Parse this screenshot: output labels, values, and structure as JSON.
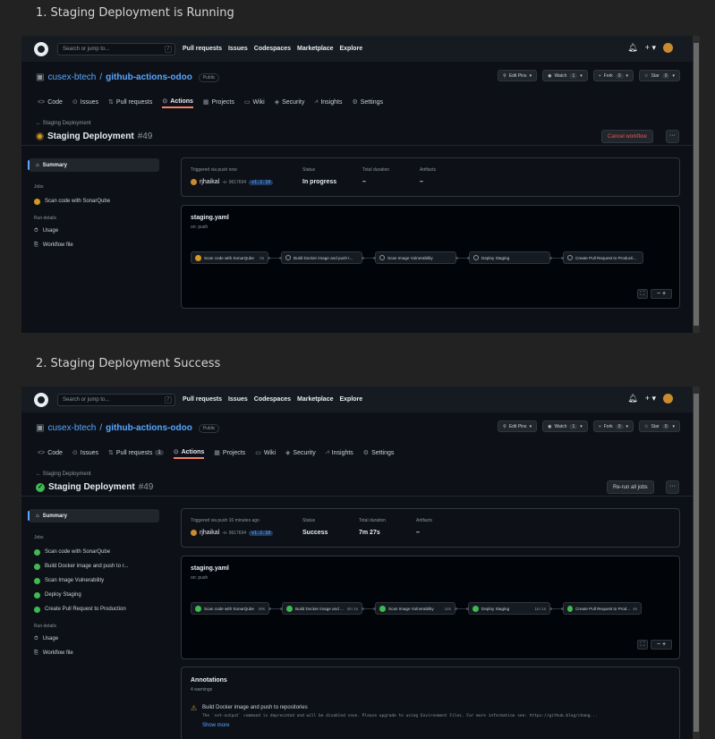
{
  "sections": [
    {
      "title": "1. Staging Deployment is Running",
      "search_placeholder": "Search or jump to...",
      "nav": [
        "Pull requests",
        "Issues",
        "Codespaces",
        "Marketplace",
        "Explore"
      ],
      "repo": {
        "owner": "cusex-btech",
        "name": "github-actions-odoo",
        "visibility": "Public"
      },
      "repo_actions": {
        "pins": "Edit Pins",
        "watch": "Watch",
        "watch_count": "1",
        "fork": "Fork",
        "fork_count": "0",
        "star": "Star",
        "star_count": "0"
      },
      "tabs": [
        "Code",
        "Issues",
        "Pull requests",
        "Actions",
        "Projects",
        "Wiki",
        "Security",
        "Insights",
        "Settings"
      ],
      "pr_count": "",
      "breadcrumb": "← Staging Deployment",
      "run_title": "Staging Deployment",
      "run_number": "#49",
      "primary_button": "Cancel workflow",
      "sidebar": {
        "summary": "Summary",
        "jobs_heading": "Jobs",
        "jobs": [
          "Scan code with SonarQube"
        ],
        "run_details_heading": "Run details",
        "usage": "Usage",
        "workflow_file": "Workflow file"
      },
      "summary": {
        "trigger_label": "Triggered via push now",
        "user": "rjhaikal",
        "sha": "-o- 9617694",
        "tag": "v1.2.10",
        "status_label": "Status",
        "status": "In progress",
        "duration_label": "Total duration",
        "duration": "–",
        "artifacts_label": "Artifacts",
        "artifacts": "–"
      },
      "graph": {
        "file": "staging.yaml",
        "on": "on: push",
        "jobs": [
          {
            "name": "Scan code with SonarQube",
            "time": "0s"
          },
          {
            "name": "Build Docker image and push t...",
            "time": ""
          },
          {
            "name": "Scan Image Vulnerability",
            "time": ""
          },
          {
            "name": "Deploy Staging",
            "time": ""
          },
          {
            "name": "Create Pull Request to Producti...",
            "time": ""
          }
        ]
      }
    },
    {
      "title": "2. Staging Deployment Success",
      "search_placeholder": "Search or jump to...",
      "nav": [
        "Pull requests",
        "Issues",
        "Codespaces",
        "Marketplace",
        "Explore"
      ],
      "repo": {
        "owner": "cusex-btech",
        "name": "github-actions-odoo",
        "visibility": "Public"
      },
      "repo_actions": {
        "pins": "Edit Pins",
        "watch": "Watch",
        "watch_count": "1",
        "fork": "Fork",
        "fork_count": "0",
        "star": "Star",
        "star_count": "0"
      },
      "tabs": [
        "Code",
        "Issues",
        "Pull requests",
        "Actions",
        "Projects",
        "Wiki",
        "Security",
        "Insights",
        "Settings"
      ],
      "pr_count": "1",
      "breadcrumb": "← Staging Deployment",
      "run_title": "Staging Deployment",
      "run_number": "#49",
      "primary_button": "Re-run all jobs",
      "sidebar": {
        "summary": "Summary",
        "jobs_heading": "Jobs",
        "jobs": [
          "Scan code with SonarQube",
          "Build Docker image and push to r...",
          "Scan Image Vulnerability",
          "Deploy Staging",
          "Create Pull Request to Production"
        ],
        "run_details_heading": "Run details",
        "usage": "Usage",
        "workflow_file": "Workflow file"
      },
      "summary": {
        "trigger_label": "Triggered via push 16 minutes ago",
        "user": "rjhaikal",
        "sha": "-o- 9617694",
        "tag": "v1.2.10",
        "status_label": "Status",
        "status": "Success",
        "duration_label": "Total duration",
        "duration": "7m 27s",
        "artifacts_label": "Artifacts",
        "artifacts": "–"
      },
      "graph": {
        "file": "staging.yaml",
        "on": "on: push",
        "jobs": [
          {
            "name": "Scan code with SonarQube",
            "time": "49s"
          },
          {
            "name": "Build Docker image and ...",
            "time": "4m 1s"
          },
          {
            "name": "Scan Image Vulnerability",
            "time": "14s"
          },
          {
            "name": "Deploy Staging",
            "time": "1m 1s"
          },
          {
            "name": "Create Pull Request to Prod...",
            "time": "4s"
          }
        ]
      },
      "annotations": {
        "title": "Annotations",
        "count": "4 warnings",
        "heading": "Build Docker image and push to repositories",
        "message": "The `set-output` command is deprecated and will be disabled soon. Please upgrade to using Environment Files. For more information see: https://github.blog/chang...",
        "more": "Show more"
      }
    }
  ]
}
